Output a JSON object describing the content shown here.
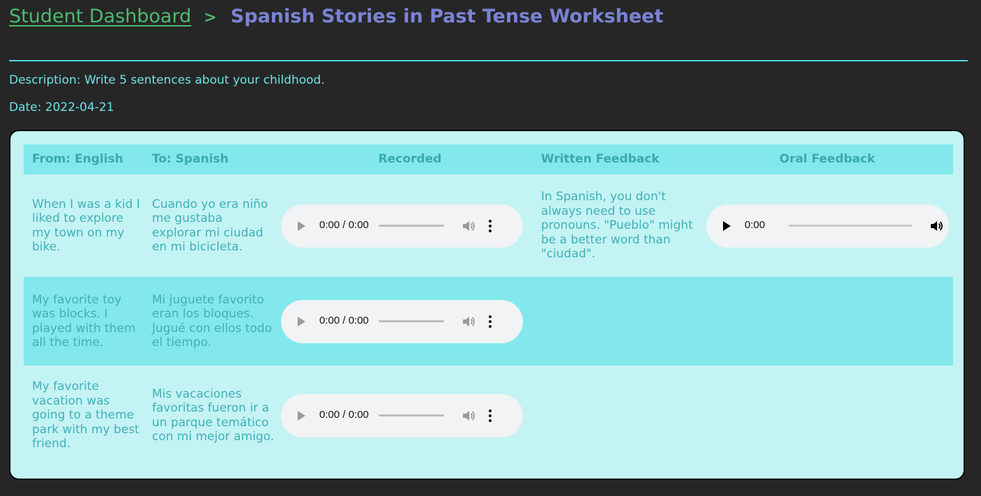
{
  "breadcrumb": {
    "link_label": "Student Dashboard",
    "separator": ">",
    "title": "Spanish Stories in Past Tense Worksheet"
  },
  "meta": {
    "description": "Description: Write 5 sentences about your childhood.",
    "date": "Date: 2022-04-21"
  },
  "table": {
    "headers": [
      "From: English",
      "To: Spanish",
      "Recorded",
      "Written Feedback",
      "Oral Feedback"
    ],
    "rows": [
      {
        "english": "When I was a kid I liked to explore my town on my bike.",
        "spanish": "Cuando yo era niño me gustaba explorar mi ciudad en mi bicicleta.",
        "recorded_time": "0:00 / 0:00",
        "written_feedback": "In Spanish, you don't always need to use pronouns. \"Pueblo\" might be a better word than \"ciudad\".",
        "oral_feedback_time": "0:00"
      },
      {
        "english": "My favorite toy was blocks. I played with them all the time.",
        "spanish": "Mi juguete favorito eran los bloques. Jugué con ellos todo el tiempo.",
        "recorded_time": "0:00 / 0:00",
        "written_feedback": "",
        "oral_feedback_time": ""
      },
      {
        "english": "My favorite vacation was going to a theme park with my best friend.",
        "spanish": "Mis vacaciones favoritas fueron ir a un parque temático con mi mejor amigo.",
        "recorded_time": "0:00 / 0:00",
        "written_feedback": "",
        "oral_feedback_time": ""
      }
    ]
  },
  "colors": {
    "page_bg": "#262626",
    "link_green": "#4cbb6e",
    "title_purple": "#7b83d6",
    "accent_cyan": "#56d8dc",
    "card_bg": "#c4f3f4",
    "row_highlight": "#82e8ec",
    "cell_text": "#3fb0b6"
  },
  "icons": {
    "play": "play-icon",
    "volume": "volume-icon",
    "more": "more-options-icon"
  }
}
